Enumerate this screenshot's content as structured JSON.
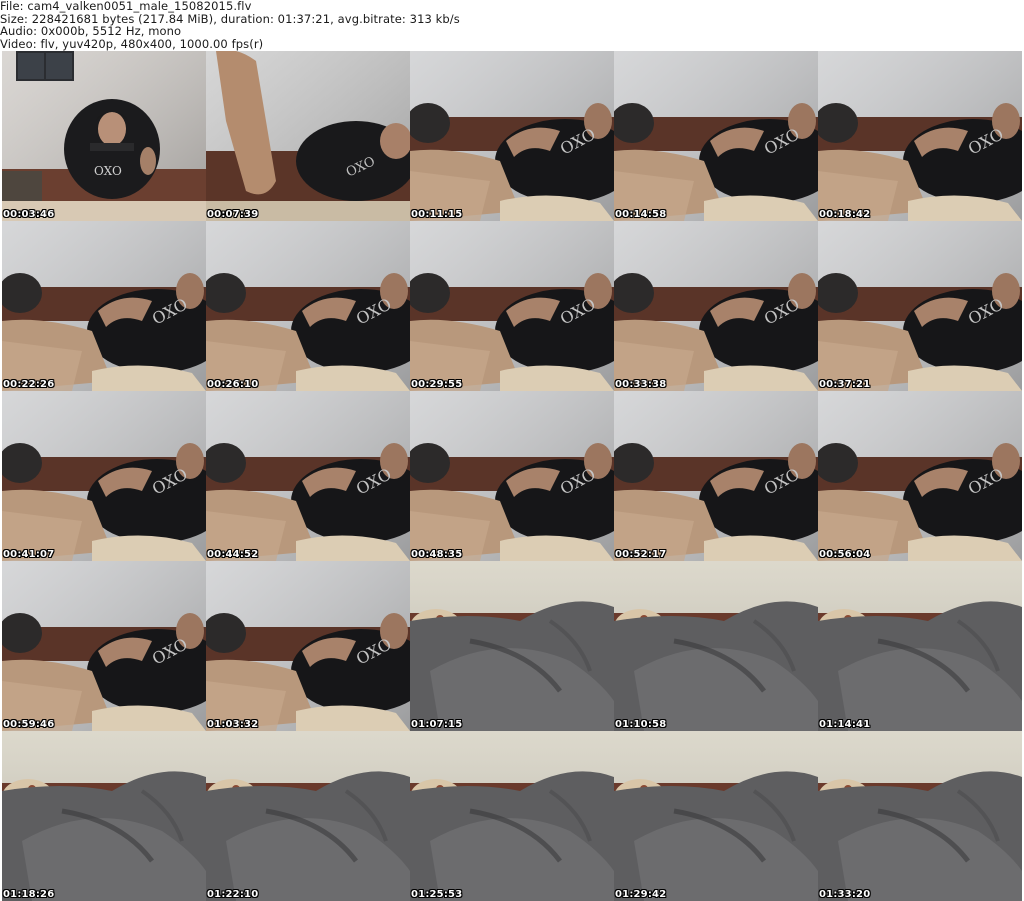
{
  "header": {
    "file_line": "File: cam4_valken0051_male_15082015.flv",
    "size_line": "Size: 228421681 bytes (217.84 MiB), duration: 01:37:21, avg.bitrate: 313 kb/s",
    "audio_line": "Audio: 0x000b, 5512 Hz, mono",
    "video_line": "Video: flv, yuv420p, 480x400, 1000.00 fps(r)"
  },
  "thumbnails": [
    {
      "time": "00:03:46",
      "scene": "seated"
    },
    {
      "time": "00:07:39",
      "scene": "leg-up"
    },
    {
      "time": "00:11:15",
      "scene": "reclined"
    },
    {
      "time": "00:14:58",
      "scene": "reclined"
    },
    {
      "time": "00:18:42",
      "scene": "reclined"
    },
    {
      "time": "00:22:26",
      "scene": "reclined"
    },
    {
      "time": "00:26:10",
      "scene": "reclined"
    },
    {
      "time": "00:29:55",
      "scene": "reclined"
    },
    {
      "time": "00:33:38",
      "scene": "reclined"
    },
    {
      "time": "00:37:21",
      "scene": "reclined"
    },
    {
      "time": "00:41:07",
      "scene": "reclined"
    },
    {
      "time": "00:44:52",
      "scene": "reclined"
    },
    {
      "time": "00:48:35",
      "scene": "reclined"
    },
    {
      "time": "00:52:17",
      "scene": "reclined"
    },
    {
      "time": "00:56:04",
      "scene": "reclined"
    },
    {
      "time": "00:59:46",
      "scene": "reclined"
    },
    {
      "time": "01:03:32",
      "scene": "reclined"
    },
    {
      "time": "01:07:15",
      "scene": "blanket"
    },
    {
      "time": "01:10:58",
      "scene": "blanket"
    },
    {
      "time": "01:14:41",
      "scene": "blanket"
    },
    {
      "time": "01:18:26",
      "scene": "blanket"
    },
    {
      "time": "01:22:10",
      "scene": "blanket"
    },
    {
      "time": "01:25:53",
      "scene": "blanket"
    },
    {
      "time": "01:29:42",
      "scene": "blanket"
    },
    {
      "time": "01:33:20",
      "scene": "blanket"
    }
  ]
}
